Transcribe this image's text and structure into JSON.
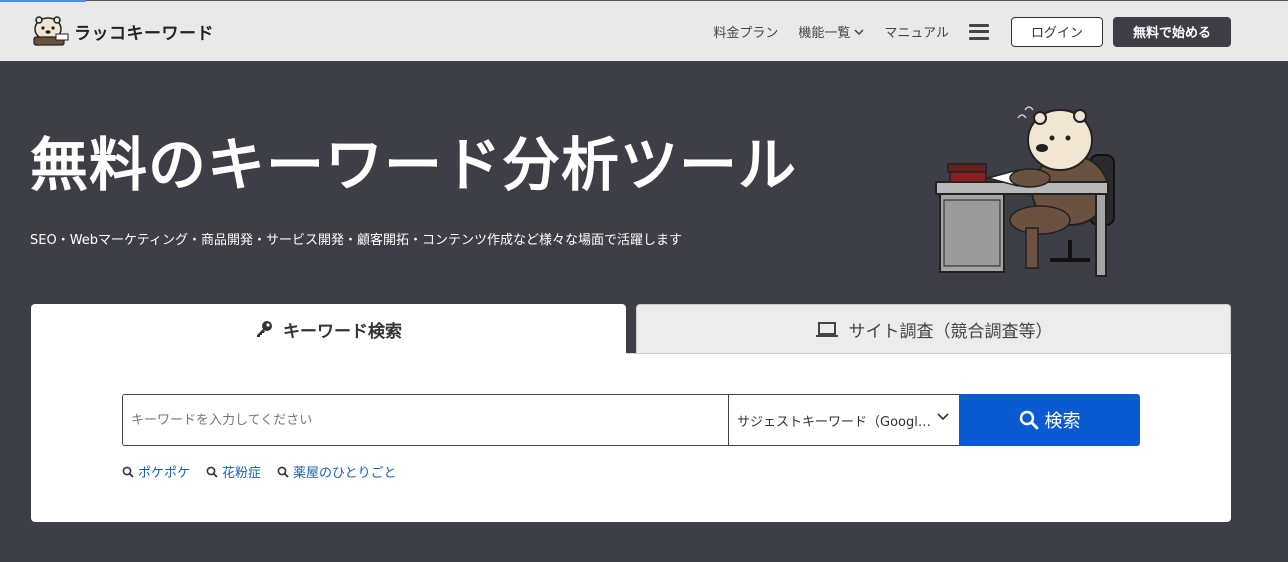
{
  "header": {
    "logo_text": "ラッコキーワード",
    "nav": [
      {
        "label": "料金プラン"
      },
      {
        "label": "機能一覧",
        "has_dropdown": true
      },
      {
        "label": "マニュアル"
      }
    ],
    "menu_icon": "hamburger-icon",
    "login_label": "ログイン",
    "start_label": "無料で始める"
  },
  "hero": {
    "title": "無料のキーワード分析ツール",
    "subtitle": "SEO・Webマーケティング・商品開発・サービス開発・顧客開拓・コンテンツ作成など様々な場面で活躍します"
  },
  "tabs": [
    {
      "label": "キーワード検索",
      "icon": "key-icon",
      "active": true
    },
    {
      "label": "サイト調査（競合調査等）",
      "icon": "laptop-icon",
      "active": false
    }
  ],
  "search": {
    "placeholder": "キーワードを入力してください",
    "value": "",
    "select_value": "サジェストキーワード（Google）",
    "button_label": "検索"
  },
  "suggestions": [
    "ポケポケ",
    "花粉症",
    "薬屋のひとりごと"
  ],
  "colors": {
    "background": "#3e3f46",
    "header": "#e9e9ea",
    "primary": "#0a5bd1",
    "link": "#1a5fb4"
  }
}
